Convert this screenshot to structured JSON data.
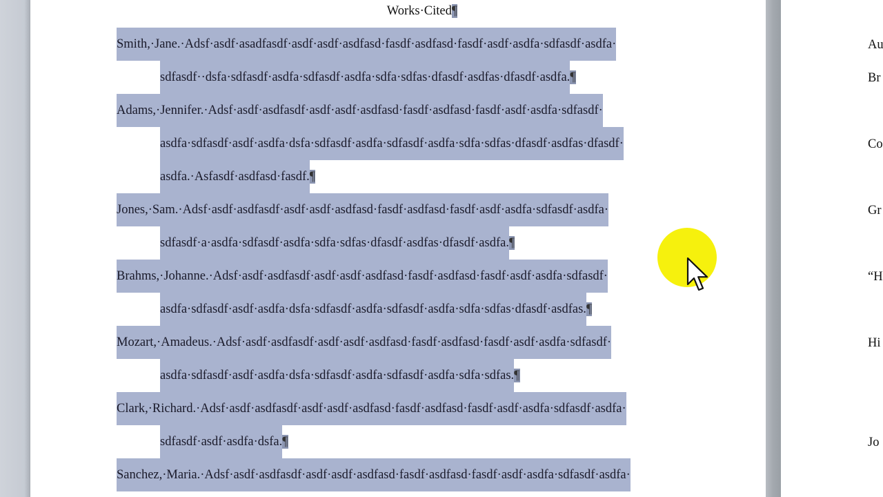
{
  "document": {
    "title": "Works·Cited",
    "title_mark": "¶",
    "paragraph_mark": "¶",
    "selection_color": "#a9b3cf",
    "entries": [
      {
        "lines": [
          "Smith,·Jane.·Adsf·asdf·asadfasdf·asdf·asdf·asdfasd·fasdf·asdfasd·fasdf·asdf·asdfa·sdfasdf·asdfa·",
          "sdfasdf··dsfa·sdfasdf·asdfa·sdfasdf·asdfa·sdfa·sdfas·dfasdf·asdfas·dfasdf·asdfa."
        ]
      },
      {
        "lines": [
          "Adams,·Jennifer.·Adsf·asdf·asdfasdf·asdf·asdf·asdfasd·fasdf·asdfasd·fasdf·asdf·asdfa·sdfasdf·",
          "asdfa·sdfasdf·asdf·asdfa·dsfa·sdfasdf·asdfa·sdfasdf·asdfa·sdfa·sdfas·dfasdf·asdfas·dfasdf·",
          "asdfa.·Asfasdf·asdfasd·fasdf."
        ]
      },
      {
        "lines": [
          "Jones,·Sam.·Adsf·asdf·asdfasdf·asdf·asdf·asdfasd·fasdf·asdfasd·fasdf·asdf·asdfa·sdfasdf·asdfa·",
          "sdfasdf·a·asdfa·sdfasdf·asdfa·sdfa·sdfas·dfasdf·asdfas·dfasdf·asdfa."
        ]
      },
      {
        "lines": [
          "Brahms,·Johanne.·Adsf·asdf·asdfasdf·asdf·asdf·asdfasd·fasdf·asdfasd·fasdf·asdf·asdfa·sdfasdf·",
          "asdfa·sdfasdf·asdf·asdfa·dsfa·sdfasdf·asdfa·sdfasdf·asdfa·sdfa·sdfas·dfasdf·asdfas."
        ]
      },
      {
        "lines": [
          "Mozart,·Amadeus.·Adsf·asdf·asdfasdf·asdf·asdf·asdfasd·fasdf·asdfasd·fasdf·asdf·asdfa·sdfasdf·",
          "asdfa·sdfasdf·asdf·asdfa·dsfa·sdfasdf·asdfa·sdfasdf·asdfa·sdfa·sdfas."
        ]
      },
      {
        "lines": [
          "Clark,·Richard.·Adsf·asdf·asdfasdf·asdf·asdf·asdfasd·fasdf·asdfasd·fasdf·asdf·asdfa·sdfasdf·asdfa·",
          "sdfasdf·asdf·asdfa·dsfa."
        ]
      },
      {
        "lines": [
          "Sanchez,·Maria.·Adsf·asdf·asdfasdf·asdf·asdf·asdfasd·fasdf·asdfasd·fasdf·asdf·asdfa·sdfasdf·asdfa·"
        ]
      }
    ]
  },
  "next_page": {
    "items": [
      "Au",
      "Br",
      "Co",
      "Gr",
      "“H",
      "Hi",
      "Jo"
    ]
  },
  "cursor": {
    "icon": "arrow-pointer-icon",
    "highlight_color": "#f5f000"
  }
}
